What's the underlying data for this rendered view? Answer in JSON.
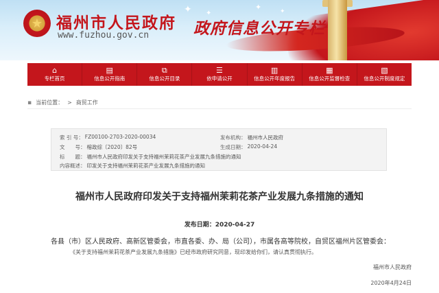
{
  "header": {
    "site_name": "福州市人民政府",
    "site_url": "www.fuzhou.gov.cn",
    "special_title": "政府信息公开专栏"
  },
  "nav": {
    "items": [
      {
        "label": "专栏首页",
        "icon": "home-icon",
        "glyph": "⌂"
      },
      {
        "label": "信息公开指南",
        "icon": "guide-icon",
        "glyph": "▤"
      },
      {
        "label": "信息公开目录",
        "icon": "catalog-icon",
        "glyph": "⧉"
      },
      {
        "label": "依申请公开",
        "icon": "apply-icon",
        "glyph": "☰"
      },
      {
        "label": "信息公开年度报告",
        "icon": "report-icon",
        "glyph": "▥"
      },
      {
        "label": "信息公开监督检查",
        "icon": "supervision-icon",
        "glyph": "▦"
      },
      {
        "label": "信息公开制度规定",
        "icon": "regulation-icon",
        "glyph": "▧"
      }
    ]
  },
  "breadcrumb": {
    "prefix": "当前位置：",
    "current": "商贸工作"
  },
  "info": {
    "index_label": "索 引 号：",
    "index_value": "FZ00100-2703-2020-00034",
    "agency_label": "发布机构：",
    "agency_value": "福州市人民政府",
    "docno_label": "文　　号：",
    "docno_value": "榕政综〔2020〕82号",
    "date_label": "生成日期：",
    "date_value": "2020-04-24",
    "title_label": "标　　题：",
    "title_value": "福州市人民政府印发关于支持福州茉莉花茶产业发展九条措施的通知",
    "summary_label": "内容概述：",
    "summary_value": "印发关于支持福州茉莉花茶产业发展九条措施的通知"
  },
  "article": {
    "title": "福州市人民政府印发关于支持福州茉莉花茶产业发展九条措施的通知",
    "pubdate": "发布日期：2020-04-27",
    "recipient": "各县（市）区人民政府、高新区管委会，市直各委、办、局（公司），市属各高等院校，自贸区福州片区管委会：",
    "body": "《关于支持福州茉莉花茶产业发展九条措施》已经市政府研究同意，现印发给你们，请认真贯彻执行。",
    "signer": "福州市人民政府",
    "signdate": "2020年4月24日"
  }
}
